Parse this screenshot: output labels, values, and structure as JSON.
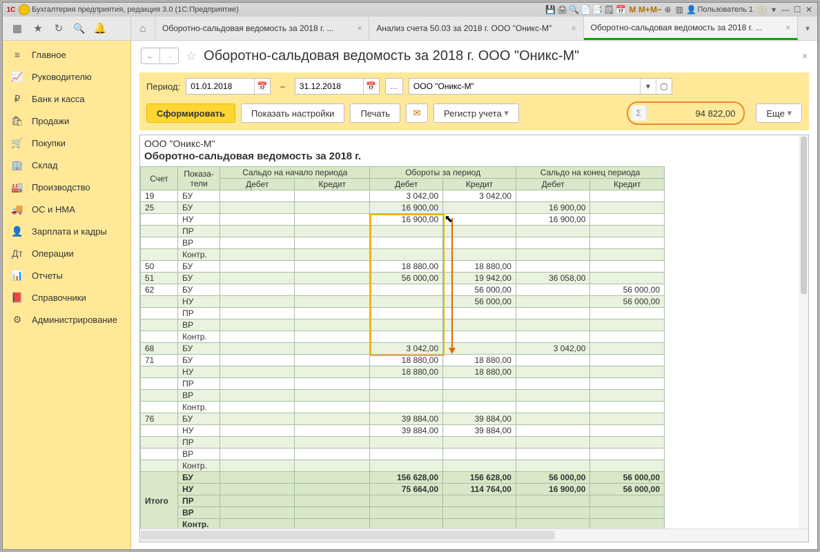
{
  "titlebar": {
    "app": "Бухгалтерия предприятия, редакция 3.0  (1С:Предприятие)",
    "user": "Пользователь 1"
  },
  "topicons": [
    "M",
    "M+",
    "M−"
  ],
  "tabs": [
    {
      "label": "Оборотно-сальдовая ведомость за 2018 г. ..."
    },
    {
      "label": "Анализ счета 50.03 за 2018 г. ООО \"Оникс-М\""
    },
    {
      "label": "Оборотно-сальдовая ведомость за 2018 г. ...",
      "active": true
    }
  ],
  "sidebar": [
    {
      "icon": "≡",
      "label": "Главное"
    },
    {
      "icon": "📈",
      "label": "Руководителю"
    },
    {
      "icon": "₽",
      "label": "Банк и касса"
    },
    {
      "icon": "🛍",
      "label": "Продажи"
    },
    {
      "icon": "🛒",
      "label": "Покупки"
    },
    {
      "icon": "🏢",
      "label": "Склад"
    },
    {
      "icon": "🏭",
      "label": "Производство"
    },
    {
      "icon": "🚚",
      "label": "ОС и НМА"
    },
    {
      "icon": "👤",
      "label": "Зарплата и кадры"
    },
    {
      "icon": "Дт",
      "label": "Операции"
    },
    {
      "icon": "📊",
      "label": "Отчеты"
    },
    {
      "icon": "📕",
      "label": "Справочники"
    },
    {
      "icon": "⚙",
      "label": "Администрирование"
    }
  ],
  "page": {
    "title": "Оборотно-сальдовая ведомость за 2018 г. ООО \"Оникс-М\"",
    "period_label": "Период:",
    "date_from": "01.01.2018",
    "date_to": "31.12.2018",
    "org": "ООО \"Оникс-М\"",
    "btn_form": "Сформировать",
    "btn_settings": "Показать настройки",
    "btn_print": "Печать",
    "btn_reg": "Регистр учета",
    "btn_more": "Еще",
    "sum": "94 822,00"
  },
  "report": {
    "org": "ООО \"Оникс-М\"",
    "title": "Оборотно-сальдовая ведомость за 2018 г.",
    "cols": {
      "acct": "Счет",
      "ind": "Показа-\nтели",
      "startD": "Дебет",
      "startK": "Кредит",
      "turnD": "Дебет",
      "turnK": "Кредит",
      "endD": "Дебет",
      "endK": "Кредит",
      "start": "Сальдо на начало периода",
      "turn": "Обороты за период",
      "end": "Сальдо на конец периода"
    },
    "total_label": "Итого",
    "rows": [
      {
        "a": "19",
        "i": "БУ",
        "td": "3 042,00",
        "tk": "3 042,00"
      },
      {
        "a": "25",
        "i": "БУ",
        "td": "16 900,00",
        "ed": "16 900,00"
      },
      {
        "a": "",
        "i": "НУ",
        "td": "16 900,00",
        "ed": "16 900,00"
      },
      {
        "a": "",
        "i": "ПР"
      },
      {
        "a": "",
        "i": "ВР"
      },
      {
        "a": "",
        "i": "Контр."
      },
      {
        "a": "50",
        "i": "БУ",
        "td": "18 880,00",
        "tk": "18 880,00"
      },
      {
        "a": "51",
        "i": "БУ",
        "td": "56 000,00",
        "tk": "19 942,00",
        "ed": "36 058,00"
      },
      {
        "a": "62",
        "i": "БУ",
        "tk": "56 000,00",
        "ek": "56 000,00"
      },
      {
        "a": "",
        "i": "НУ",
        "tk": "56 000,00",
        "ek": "56 000,00"
      },
      {
        "a": "",
        "i": "ПР"
      },
      {
        "a": "",
        "i": "ВР"
      },
      {
        "a": "",
        "i": "Контр."
      },
      {
        "a": "68",
        "i": "БУ",
        "td": "3 042,00",
        "ed": "3 042,00"
      },
      {
        "a": "71",
        "i": "БУ",
        "td": "18 880,00",
        "tk": "18 880,00"
      },
      {
        "a": "",
        "i": "НУ",
        "td": "18 880,00",
        "tk": "18 880,00"
      },
      {
        "a": "",
        "i": "ПР"
      },
      {
        "a": "",
        "i": "ВР"
      },
      {
        "a": "",
        "i": "Контр."
      },
      {
        "a": "76",
        "i": "БУ",
        "td": "39 884,00",
        "tk": "39 884,00"
      },
      {
        "a": "",
        "i": "НУ",
        "td": "39 884,00",
        "tk": "39 884,00"
      },
      {
        "a": "",
        "i": "ПР"
      },
      {
        "a": "",
        "i": "ВР"
      },
      {
        "a": "",
        "i": "Контр."
      }
    ],
    "totals": [
      {
        "i": "БУ",
        "td": "156 628,00",
        "tk": "156 628,00",
        "ed": "56 000,00",
        "ek": "56 000,00"
      },
      {
        "i": "НУ",
        "td": "75 664,00",
        "tk": "114 764,00",
        "ed": "16 900,00",
        "ek": "56 000,00"
      },
      {
        "i": "ПР"
      },
      {
        "i": "ВР"
      },
      {
        "i": "Контр."
      }
    ]
  }
}
